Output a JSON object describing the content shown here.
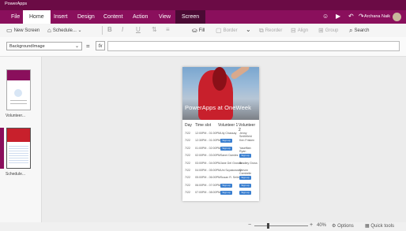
{
  "window": {
    "title": "PowerApps"
  },
  "menu": {
    "tabs": [
      "File",
      "Home",
      "Insert",
      "Design",
      "Content",
      "Action",
      "View",
      "Screen"
    ],
    "active_tab": "Home",
    "user": "Archana Naik"
  },
  "toolbar": {
    "new_screen": "New Screen",
    "schedule": "Schedule...",
    "bold": "B",
    "italic": "I",
    "underline": "U",
    "fill": "Fill",
    "border": "Border",
    "reorder": "Reorder",
    "align": "Align",
    "group": "Group",
    "search": "Search"
  },
  "formula_bar": {
    "property": "BackgroundImage",
    "equals": "=",
    "fx": "fx"
  },
  "screens": [
    {
      "label": "Volunteer..."
    },
    {
      "label": "Schedule..."
    }
  ],
  "app_screen": {
    "hero_text": "PowerApps at OneWeek",
    "columns": [
      "Day",
      "Time slot",
      "Volunteer 1",
      "Volunteer 2"
    ],
    "rows": [
      {
        "day": "7/22",
        "time": "12:00PM - 01:00PM",
        "v1": "Lily Chassay",
        "v2": "Jenny Smithfield"
      },
      {
        "day": "7/22",
        "time": "12:30PM - 01:00PM",
        "v1": "Sign up",
        "v2": "Ken Frisken"
      },
      {
        "day": "7/22",
        "time": "01:00PM - 02:00PM",
        "v1": "Sign up",
        "v2": "Yaseffiah Ryan"
      },
      {
        "day": "7/22",
        "time": "02:00PM - 03:00PM",
        "v1": "Sanni Damles",
        "v2": "Sign up"
      },
      {
        "day": "7/22",
        "time": "03:00PM - 04:00PM",
        "v1": "Jane Del Grossie",
        "v2": "Bradley Gross"
      },
      {
        "day": "7/22",
        "time": "04:00PM - 05:00PM",
        "v1": "Uni Szpakowsky",
        "v2": "Steven Cambelle"
      },
      {
        "day": "7/22",
        "time": "05:00PM - 06:00PM",
        "v1": "Susan R. Seiler",
        "v2": "Sign up"
      },
      {
        "day": "7/22",
        "time": "06:00PM - 07:00PM",
        "v1": "Sign up",
        "v2": "Sign up"
      },
      {
        "day": "7/22",
        "time": "07:00PM - 08:00PM",
        "v1": "Sign up",
        "v2": "Sign up"
      }
    ]
  },
  "status": {
    "zoom": "40%",
    "options": "Options",
    "quick_tools": "Quick tools"
  },
  "colors": {
    "brand": "#8a0f5c",
    "brand_dark": "#6b0b45",
    "signup_button": "#3a7fd0"
  }
}
